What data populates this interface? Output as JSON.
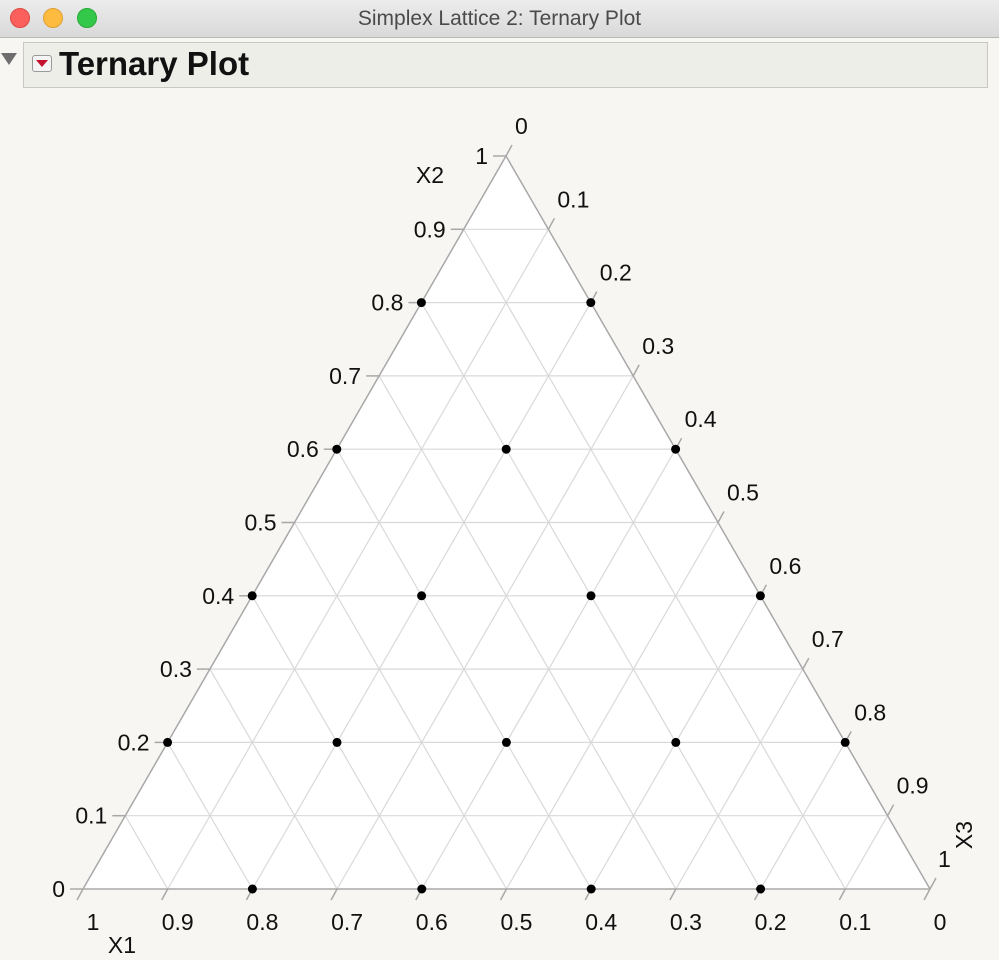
{
  "window": {
    "title": "Simplex Lattice 2: Ternary Plot"
  },
  "outline": {
    "title": "Ternary Plot"
  },
  "chart_data": {
    "type": "scatter",
    "subtype": "ternary",
    "axes": {
      "X1": {
        "label": "X1",
        "ticks": [
          "1",
          "0.9",
          "0.8",
          "0.7",
          "0.6",
          "0.5",
          "0.4",
          "0.3",
          "0.2",
          "0.1",
          "0"
        ]
      },
      "X2": {
        "label": "X2",
        "ticks": [
          "0",
          "0.1",
          "0.2",
          "0.3",
          "0.4",
          "0.5",
          "0.6",
          "0.7",
          "0.8",
          "0.9",
          "1"
        ]
      },
      "X3": {
        "label": "X3",
        "ticks": [
          "0",
          "0.1",
          "0.2",
          "0.3",
          "0.4",
          "0.5",
          "0.6",
          "0.7",
          "0.8",
          "0.9",
          "1"
        ]
      }
    },
    "grid": true,
    "grid_step": 0.1,
    "points": [
      {
        "X1": 0.2,
        "X2": 0.8,
        "X3": 0.0
      },
      {
        "X1": 0.0,
        "X2": 0.8,
        "X3": 0.2
      },
      {
        "X1": 0.2,
        "X2": 0.6,
        "X3": 0.2
      },
      {
        "X1": 0.4,
        "X2": 0.6,
        "X3": 0.0
      },
      {
        "X1": 0.0,
        "X2": 0.6,
        "X3": 0.4
      },
      {
        "X1": 0.4,
        "X2": 0.4,
        "X3": 0.2
      },
      {
        "X1": 0.2,
        "X2": 0.4,
        "X3": 0.4
      },
      {
        "X1": 0.6,
        "X2": 0.4,
        "X3": 0.0
      },
      {
        "X1": 0.0,
        "X2": 0.4,
        "X3": 0.6
      },
      {
        "X1": 0.6,
        "X2": 0.2,
        "X3": 0.2
      },
      {
        "X1": 0.4,
        "X2": 0.2,
        "X3": 0.4
      },
      {
        "X1": 0.2,
        "X2": 0.2,
        "X3": 0.6
      },
      {
        "X1": 0.8,
        "X2": 0.2,
        "X3": 0.0
      },
      {
        "X1": 0.0,
        "X2": 0.2,
        "X3": 0.8
      },
      {
        "X1": 0.8,
        "X2": 0.0,
        "X3": 0.2
      },
      {
        "X1": 0.6,
        "X2": 0.0,
        "X3": 0.4
      },
      {
        "X1": 0.4,
        "X2": 0.0,
        "X3": 0.6
      },
      {
        "X1": 0.2,
        "X2": 0.0,
        "X3": 0.8
      }
    ],
    "colors": {
      "grid": "#d9d9d9",
      "frame": "#a8a8a8",
      "points": "#000000",
      "background": "#ffffff"
    }
  }
}
